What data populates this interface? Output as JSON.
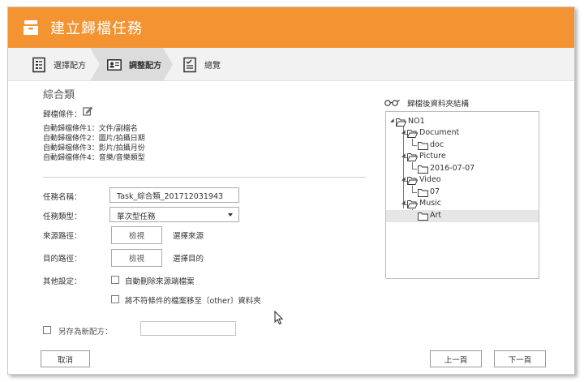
{
  "window": {
    "title": "建立歸檔任務"
  },
  "steps": [
    {
      "label": "選擇配方",
      "icon": "document-list-icon"
    },
    {
      "label": "調整配方",
      "icon": "id-card-icon"
    },
    {
      "label": "總覽",
      "icon": "checklist-icon"
    }
  ],
  "recipe": {
    "name": "綜合類",
    "conditions_label": "歸檔條件：",
    "conditions": [
      "自動歸檔條件1：文件/副檔名",
      "自動歸檔條件2：圖片/拍攝日期",
      "自動歸檔條件3：影片/拍攝月份",
      "自動歸檔條件4：音樂/音樂類型"
    ]
  },
  "form": {
    "task_name_label": "任務名稱：",
    "task_name_value": "Task_綜合類_201712031943",
    "task_type_label": "任務類型：",
    "task_type_value": "單次型任務",
    "source_label": "來源路徑：",
    "source_browse": "檢視",
    "source_hint": "選擇來源",
    "dest_label": "目的路徑：",
    "dest_browse": "檢視",
    "dest_hint": "選擇目的",
    "other_label": "其他設定：",
    "option_delete_source": "自動刪除來源端檔案",
    "option_move_other": "將不符條件的檔案移至〔other〕資料夾",
    "save_recipe_label": "另存為新配方："
  },
  "tree": {
    "title": "歸檔後資料夾結構",
    "nodes": [
      {
        "label": "NO1",
        "level": 0,
        "expanded": true
      },
      {
        "label": "Document",
        "level": 1,
        "expanded": true
      },
      {
        "label": "doc",
        "level": 2
      },
      {
        "label": "Picture",
        "level": 1,
        "expanded": true
      },
      {
        "label": "2016-07-07",
        "level": 2
      },
      {
        "label": "Video",
        "level": 1,
        "expanded": true
      },
      {
        "label": "07",
        "level": 2
      },
      {
        "label": "Music",
        "level": 1,
        "expanded": true
      },
      {
        "label": "Art",
        "level": 2,
        "selected": true
      }
    ]
  },
  "footer": {
    "cancel": "取消",
    "prev": "上一頁",
    "next": "下一頁"
  },
  "colors": {
    "accent": "#f39331",
    "selected_row": "#e6e6e6"
  }
}
